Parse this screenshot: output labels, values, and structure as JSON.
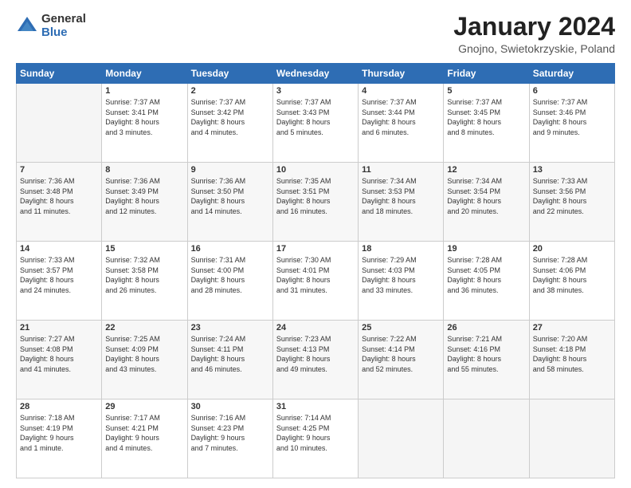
{
  "logo": {
    "general": "General",
    "blue": "Blue"
  },
  "title": "January 2024",
  "subtitle": "Gnojno, Swietokrzyskie, Poland",
  "days_header": [
    "Sunday",
    "Monday",
    "Tuesday",
    "Wednesday",
    "Thursday",
    "Friday",
    "Saturday"
  ],
  "weeks": [
    [
      {
        "day": "",
        "info": "",
        "empty": true
      },
      {
        "day": "1",
        "info": "Sunrise: 7:37 AM\nSunset: 3:41 PM\nDaylight: 8 hours\nand 3 minutes."
      },
      {
        "day": "2",
        "info": "Sunrise: 7:37 AM\nSunset: 3:42 PM\nDaylight: 8 hours\nand 4 minutes."
      },
      {
        "day": "3",
        "info": "Sunrise: 7:37 AM\nSunset: 3:43 PM\nDaylight: 8 hours\nand 5 minutes."
      },
      {
        "day": "4",
        "info": "Sunrise: 7:37 AM\nSunset: 3:44 PM\nDaylight: 8 hours\nand 6 minutes."
      },
      {
        "day": "5",
        "info": "Sunrise: 7:37 AM\nSunset: 3:45 PM\nDaylight: 8 hours\nand 8 minutes."
      },
      {
        "day": "6",
        "info": "Sunrise: 7:37 AM\nSunset: 3:46 PM\nDaylight: 8 hours\nand 9 minutes."
      }
    ],
    [
      {
        "day": "7",
        "info": "Sunrise: 7:36 AM\nSunset: 3:48 PM\nDaylight: 8 hours\nand 11 minutes."
      },
      {
        "day": "8",
        "info": "Sunrise: 7:36 AM\nSunset: 3:49 PM\nDaylight: 8 hours\nand 12 minutes."
      },
      {
        "day": "9",
        "info": "Sunrise: 7:36 AM\nSunset: 3:50 PM\nDaylight: 8 hours\nand 14 minutes."
      },
      {
        "day": "10",
        "info": "Sunrise: 7:35 AM\nSunset: 3:51 PM\nDaylight: 8 hours\nand 16 minutes."
      },
      {
        "day": "11",
        "info": "Sunrise: 7:34 AM\nSunset: 3:53 PM\nDaylight: 8 hours\nand 18 minutes."
      },
      {
        "day": "12",
        "info": "Sunrise: 7:34 AM\nSunset: 3:54 PM\nDaylight: 8 hours\nand 20 minutes."
      },
      {
        "day": "13",
        "info": "Sunrise: 7:33 AM\nSunset: 3:56 PM\nDaylight: 8 hours\nand 22 minutes."
      }
    ],
    [
      {
        "day": "14",
        "info": "Sunrise: 7:33 AM\nSunset: 3:57 PM\nDaylight: 8 hours\nand 24 minutes."
      },
      {
        "day": "15",
        "info": "Sunrise: 7:32 AM\nSunset: 3:58 PM\nDaylight: 8 hours\nand 26 minutes."
      },
      {
        "day": "16",
        "info": "Sunrise: 7:31 AM\nSunset: 4:00 PM\nDaylight: 8 hours\nand 28 minutes."
      },
      {
        "day": "17",
        "info": "Sunrise: 7:30 AM\nSunset: 4:01 PM\nDaylight: 8 hours\nand 31 minutes."
      },
      {
        "day": "18",
        "info": "Sunrise: 7:29 AM\nSunset: 4:03 PM\nDaylight: 8 hours\nand 33 minutes."
      },
      {
        "day": "19",
        "info": "Sunrise: 7:28 AM\nSunset: 4:05 PM\nDaylight: 8 hours\nand 36 minutes."
      },
      {
        "day": "20",
        "info": "Sunrise: 7:28 AM\nSunset: 4:06 PM\nDaylight: 8 hours\nand 38 minutes."
      }
    ],
    [
      {
        "day": "21",
        "info": "Sunrise: 7:27 AM\nSunset: 4:08 PM\nDaylight: 8 hours\nand 41 minutes."
      },
      {
        "day": "22",
        "info": "Sunrise: 7:25 AM\nSunset: 4:09 PM\nDaylight: 8 hours\nand 43 minutes."
      },
      {
        "day": "23",
        "info": "Sunrise: 7:24 AM\nSunset: 4:11 PM\nDaylight: 8 hours\nand 46 minutes."
      },
      {
        "day": "24",
        "info": "Sunrise: 7:23 AM\nSunset: 4:13 PM\nDaylight: 8 hours\nand 49 minutes."
      },
      {
        "day": "25",
        "info": "Sunrise: 7:22 AM\nSunset: 4:14 PM\nDaylight: 8 hours\nand 52 minutes."
      },
      {
        "day": "26",
        "info": "Sunrise: 7:21 AM\nSunset: 4:16 PM\nDaylight: 8 hours\nand 55 minutes."
      },
      {
        "day": "27",
        "info": "Sunrise: 7:20 AM\nSunset: 4:18 PM\nDaylight: 8 hours\nand 58 minutes."
      }
    ],
    [
      {
        "day": "28",
        "info": "Sunrise: 7:18 AM\nSunset: 4:19 PM\nDaylight: 9 hours\nand 1 minute."
      },
      {
        "day": "29",
        "info": "Sunrise: 7:17 AM\nSunset: 4:21 PM\nDaylight: 9 hours\nand 4 minutes."
      },
      {
        "day": "30",
        "info": "Sunrise: 7:16 AM\nSunset: 4:23 PM\nDaylight: 9 hours\nand 7 minutes."
      },
      {
        "day": "31",
        "info": "Sunrise: 7:14 AM\nSunset: 4:25 PM\nDaylight: 9 hours\nand 10 minutes."
      },
      {
        "day": "",
        "info": "",
        "empty": true
      },
      {
        "day": "",
        "info": "",
        "empty": true
      },
      {
        "day": "",
        "info": "",
        "empty": true
      }
    ]
  ]
}
